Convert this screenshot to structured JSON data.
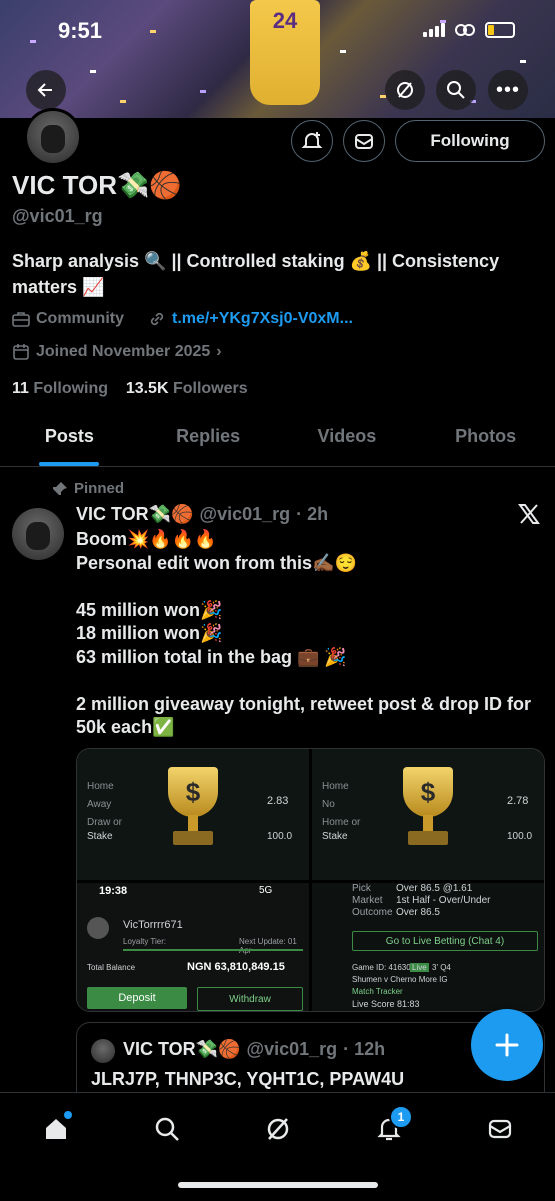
{
  "status_bar": {
    "time": "9:51"
  },
  "banner": {
    "jersey_number": "24"
  },
  "profile": {
    "display_name": "VIC TOR💸🏀",
    "handle": "@vic01_rg",
    "follow_button": "Following",
    "bio": "Sharp analysis 🔍 || Controlled staking 💰 || Consistency matters 📈",
    "category": "Community",
    "link": "t.me/+YKg7Xsj0-V0xM...",
    "joined": "Joined November 2025",
    "following_count": "11",
    "following_label": "Following",
    "followers_count": "13.5K",
    "followers_label": "Followers"
  },
  "tabs": [
    {
      "label": "Posts",
      "active": true
    },
    {
      "label": "Replies",
      "active": false
    },
    {
      "label": "Videos",
      "active": false
    },
    {
      "label": "Photos",
      "active": false
    }
  ],
  "post": {
    "pinned_label": "Pinned",
    "author_name": "VIC TOR💸🏀",
    "author_handle": "@vic01_rg",
    "time": "· 2h",
    "body": "Boom💥🔥🔥🔥\nPersonal edit won from this✍🏾😌\n\n45 million won🎉\n18 million won🎉\n63 million total in the bag 💼 🎉\n\n2 million giveaway tonight, retweet post & drop ID for 50k each✅",
    "media": {
      "tile1": {
        "odds": "2.83",
        "stake": "100.0",
        "stake_label": "Stake",
        "lines": [
          "Home",
          "Away",
          "Draw or"
        ]
      },
      "tile2": {
        "odds": "2.78",
        "stake": "100.0",
        "stake_label": "Stake",
        "lines": [
          "Home",
          "No",
          "Home or"
        ]
      },
      "tile3": {
        "time": "19:38",
        "network": "5G",
        "username": "VicTorrrr671",
        "loyalty": "Loyalty Tier:",
        "next_update": "Next Update: 01 Apr",
        "balance_label": "Total Balance",
        "balance": "NGN 63,810,849.15",
        "deposit": "Deposit",
        "withdraw": "Withdraw"
      },
      "tile4": {
        "pick_label": "Pick",
        "pick": "Over 86.5 @1.61",
        "market_label": "Market",
        "market": "1st Half - Over/Under",
        "outcome_label": "Outcome",
        "outcome": "Over 86.5",
        "live_btn": "Go to Live Betting (Chat 4)",
        "game_id": "Game ID: 41630",
        "live": "Live",
        "quarter": "3' Q4",
        "teams": "Shumen v Cherno More IG",
        "tracker": "Match Tracker",
        "score": "Live Score  81:83"
      }
    }
  },
  "quote": {
    "author_name": "VIC TOR💸🏀",
    "author_handle": "@vic01_rg",
    "time": "· 12h",
    "body": "JLRJ7P, THNP3C, YQHT1C, PPAW4U"
  },
  "nav": {
    "notification_count": "1"
  },
  "colors": {
    "accent": "#1d9bf0",
    "background": "#000000",
    "muted": "#71767b"
  }
}
